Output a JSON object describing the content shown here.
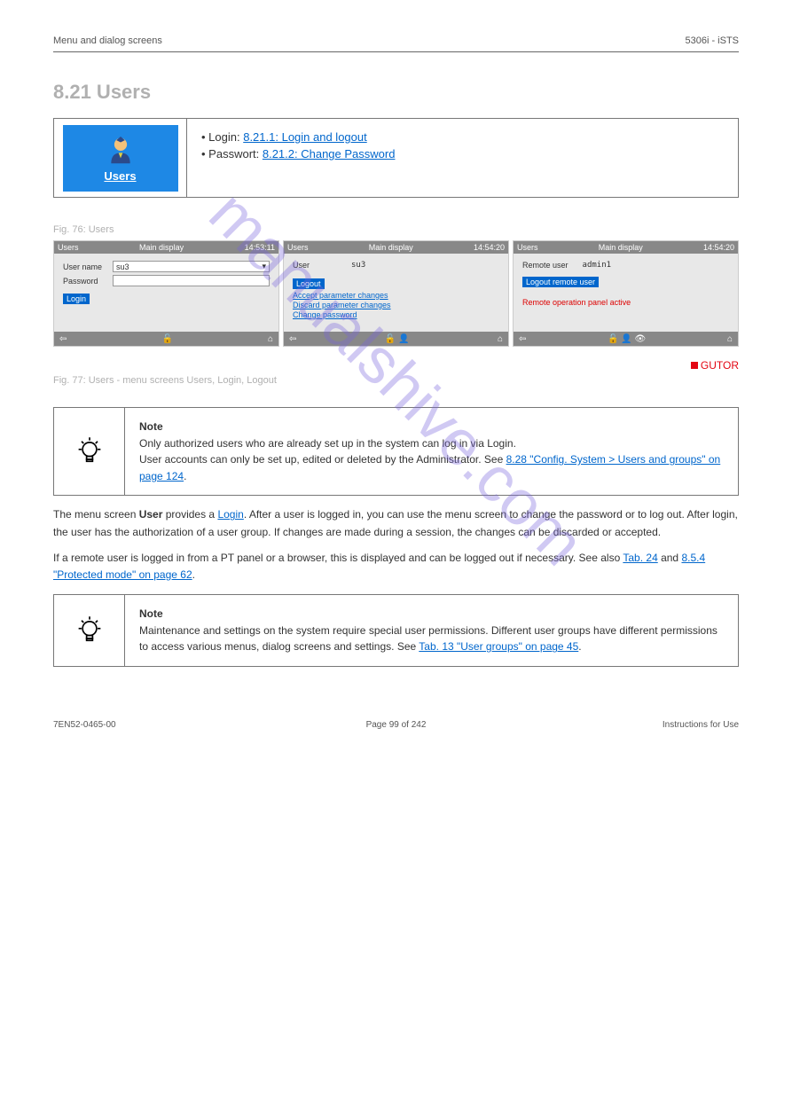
{
  "header": {
    "left": "Menu and dialog screens",
    "right": "5306i - iSTS"
  },
  "section_title": "8.21 Users",
  "tile": {
    "label": "Users"
  },
  "box_bullets": {
    "prefix_a": "Login: ",
    "link_a": "8.21.1:  Login and logout",
    "prefix_b": "Passwort: ",
    "link_b": "8.21.2:  Change Password"
  },
  "fig_caption": "Fig. 76: Users",
  "shots": {
    "s1": {
      "hdr_left": "Users",
      "hdr_mid": "Main display",
      "hdr_right": "14:53:11",
      "user_label": "User name",
      "user_value": "su3",
      "pass_label": "Password",
      "login": "Login"
    },
    "s2": {
      "hdr_left": "Users",
      "hdr_mid": "Main display",
      "hdr_right": "14:54:20",
      "user_label": "User",
      "user_value": "su3",
      "l1": "Logout",
      "l2": "Accept parameter changes",
      "l3": "Discard parameter changes",
      "l4": "Change password"
    },
    "s3": {
      "hdr_left": "Users",
      "hdr_mid": "Main display",
      "hdr_right": "14:54:20",
      "remote_label": "Remote user",
      "remote_value": "admin1",
      "btn": "Logout remote user",
      "warn": "Remote operation panel active"
    }
  },
  "brand": "GUTOR",
  "after_caption": "Fig. 77: Users - menu screens Users, Login, Logout",
  "note1": {
    "title": "Note",
    "p1": "Only authorized users who are already set up in the system can log in via Login.",
    "p2_a": "User accounts can only be set up, edited or deleted by the Administrator. See ",
    "p2_link": "8.28 \"Config. System > Users and groups\" on page 124",
    "p2_b": "."
  },
  "para1_a": "The menu screen ",
  "para1_b": "User",
  "para1_c": " provides a ",
  "para1_d": "Login",
  "para1_e": ". After a user is logged in, you can use the menu screen to change the password or to log out. After login, the user has the authorization of a user group. If changes are made during a session, the changes can be discarded or accepted.",
  "para2_a": "If a remote user is logged in from a PT panel or a browser, this is displayed and can be logged out if necessary. See also ",
  "para2_link1": "Tab. 24",
  "para2_b": " and ",
  "para2_link2": "8.5.4 \"Protected mode\" on page 62",
  "para2_c": ".",
  "note2": {
    "title": "Note",
    "p1": "Maintenance and settings on the system require special user permissions. Different user groups have different permissions to access various menus, dialog screens and settings. See ",
    "p1_link": "Tab. 13 \"User groups\" on page 45",
    "p1_b": "."
  },
  "footer": {
    "left": "7EN52-0465-00",
    "center": "Page 99 of 242",
    "right": "Instructions for Use"
  },
  "watermark": "manualshive.com"
}
